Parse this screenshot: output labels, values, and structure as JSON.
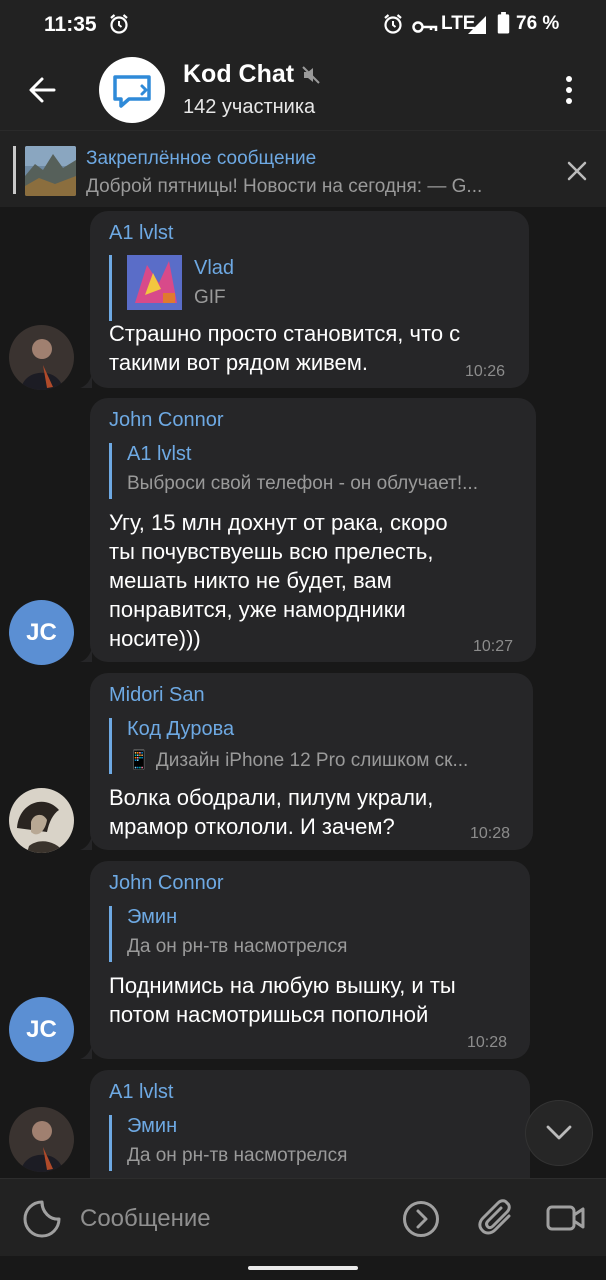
{
  "status_bar": {
    "time": "11:35",
    "network": "LTE",
    "battery": "76 %"
  },
  "header": {
    "title": "Kod Chat",
    "subtitle": "142 участника",
    "icons": {
      "back": "arrow-left-icon",
      "more": "kebab-menu-icon",
      "mute": "muted-speaker-icon"
    }
  },
  "pinned": {
    "title": "Закреплённое сообщение",
    "text": "Доброй пятницы! Новости на сегодня:  — G..."
  },
  "messages": [
    {
      "sender": "A1 lvlst",
      "reply_name": "Vlad",
      "reply_text": "GIF",
      "text": "Страшно просто становится, что с\nтакими вот рядом живем.",
      "time": "10:26"
    },
    {
      "sender": "John Connor",
      "avatar_initials": "JC",
      "reply_name": "A1 lvlst",
      "reply_text": "Выброси свой телефон - он облучает!...",
      "text": "Угу, 15 млн дохнут от рака, скоро\nты почувствуешь всю прелесть,\nмешать никто не будет, вам\nпонравится, уже намордники\nносите)))",
      "time": "10:27"
    },
    {
      "sender": "Midori San",
      "reply_name": "Код Дурова",
      "reply_text": "📱 Дизайн iPhone 12 Pro слишком ск...",
      "text": "Волка ободрали, пилум украли,\nмрамор откололи. И зачем?",
      "time": "10:28"
    },
    {
      "sender": "John Connor",
      "avatar_initials": "JC",
      "reply_name": "Эмин",
      "reply_text": "Да он рн-тв насмотрелся",
      "text": "Поднимись на любую вышку, и ты\nпотом насмотришься пополной",
      "time": "10:28"
    },
    {
      "sender": "A1 lvlst",
      "reply_name": "Эмин",
      "reply_text": "Да он рн-тв насмотрелся"
    }
  ],
  "composer": {
    "placeholder": "Сообщение"
  },
  "colors": {
    "background": "#181818",
    "panel": "#222222",
    "bubble": "#262628",
    "accent": "#6ea9e3",
    "muted_text": "#9a9a9a",
    "avatar_jc": "#5b8fd3"
  }
}
